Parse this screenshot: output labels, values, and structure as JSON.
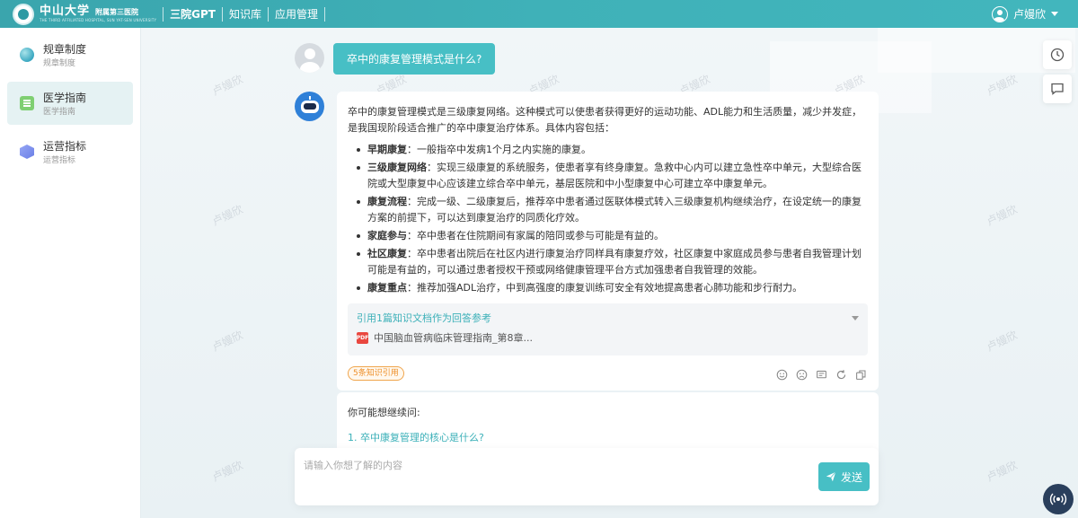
{
  "header": {
    "logo_university": "中山大学",
    "logo_hospital": "附属第三医院",
    "logo_english": "THE THIRD AFFILIATED HOSPITAL, SUN YAT-SEN UNIVERSITY",
    "nav": [
      "三院GPT",
      "知识库",
      "应用管理"
    ],
    "user_name": "卢嫚欣"
  },
  "sidebar": {
    "items": [
      {
        "label": "规章制度",
        "sub": "规章制度",
        "icon": "globe-icon"
      },
      {
        "label": "医学指南",
        "sub": "医学指南",
        "icon": "document-icon",
        "active": true
      },
      {
        "label": "运营指标",
        "sub": "运营指标",
        "icon": "cube-icon"
      }
    ]
  },
  "chat": {
    "question": "卒中的康复管理模式是什么?",
    "answer_intro": "卒中的康复管理模式是三级康复网络。这种模式可以使患者获得更好的运动功能、ADL能力和生活质量，减少并发症，是我国现阶段适合推广的卒中康复治疗体系。具体内容包括：",
    "answer_points": [
      {
        "title": "早期康复",
        "text": "：一般指卒中发病1个月之内实施的康复。"
      },
      {
        "title": "三级康复网络",
        "text": "：实现三级康复的系统服务，使患者享有终身康复。急救中心内可以建立急性卒中单元，大型综合医院或大型康复中心应该建立综合卒中单元，基层医院和中小型康复中心可建立卒中康复单元。"
      },
      {
        "title": "康复流程",
        "text": "：完成一级、二级康复后，推荐卒中患者通过医联体模式转入三级康复机构继续治疗，在设定统一的康复方案的前提下，可以达到康复治疗的同质化疗效。"
      },
      {
        "title": "家庭参与",
        "text": "：卒中患者在住院期间有家属的陪同或参与可能是有益的。"
      },
      {
        "title": "社区康复",
        "text": "：卒中患者出院后在社区内进行康复治疗同样具有康复疗效，社区康复中家庭成员参与患者自我管理计划可能是有益的，可以通过患者授权干预或网络健康管理平台方式加强患者自我管理的效能。"
      },
      {
        "title": "康复重点",
        "text": "：推荐加强ADL治疗，中到高强度的康复训练可安全有效地提高患者心肺功能和步行耐力。"
      }
    ],
    "reference_title": "引用1篇知识文档作为回答参考",
    "reference_file": "中国脑血管病临床管理指南_第8章...",
    "knowledge_tag": "5条知识引用",
    "follow_up_title": "你可能想继续问:",
    "follow_up_items": [
      "1. 卒中康复管理的核心是什么?"
    ]
  },
  "input": {
    "placeholder": "请输入你想了解的内容",
    "send_label": "发送"
  },
  "watermark_text": "卢嫚欣",
  "colors": {
    "accent": "#47bfc5",
    "header": "#3fb1b8",
    "link": "#3bb0b8",
    "tag_orange": "#ee8f2a",
    "bot_avatar": "#2f80d8",
    "voice_button": "#2a3f5c"
  }
}
